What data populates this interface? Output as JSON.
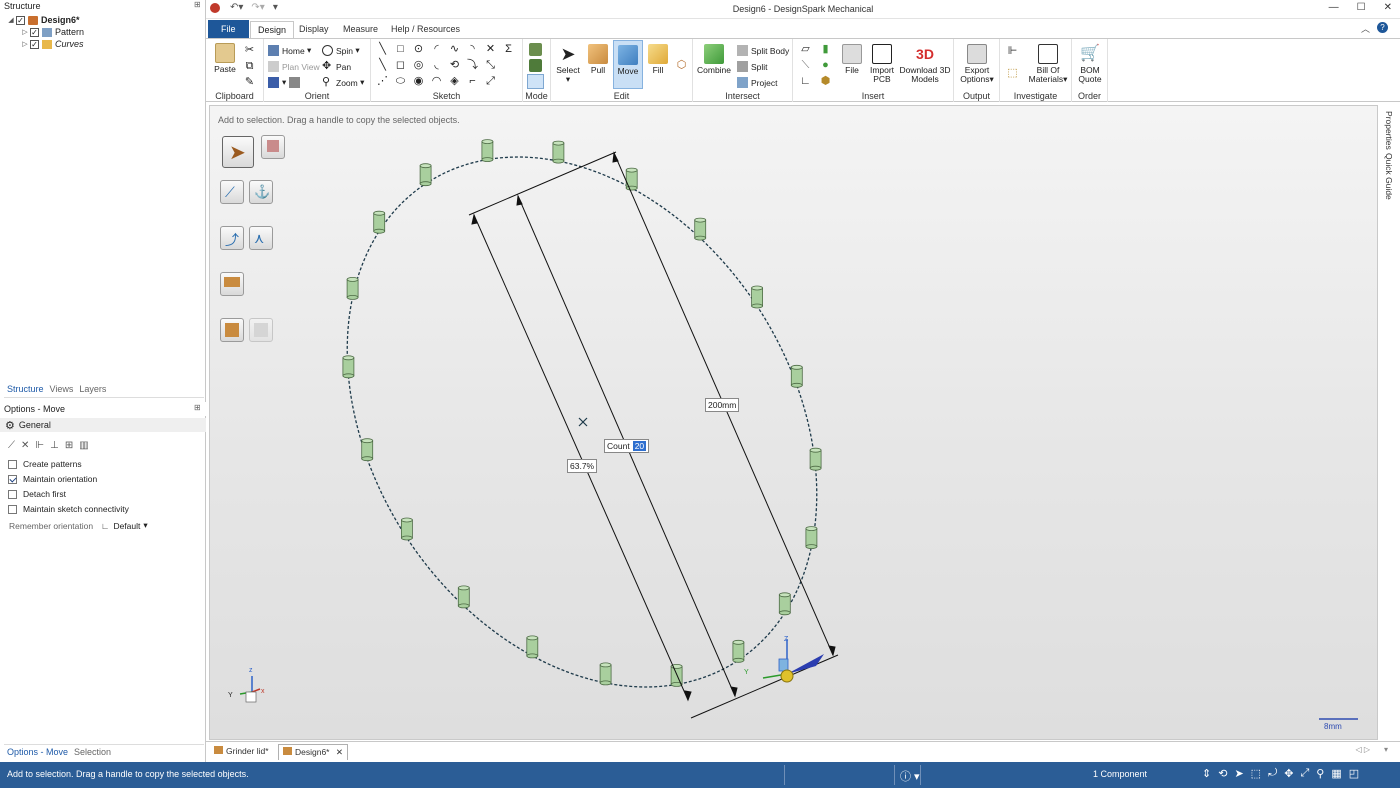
{
  "app": {
    "title": "Design6 - DesignSpark Mechanical"
  },
  "structure": {
    "header": "Structure",
    "items": [
      {
        "label": "Design6*",
        "level": 0
      },
      {
        "label": "Pattern",
        "level": 1
      },
      {
        "label": "Curves",
        "level": 1
      }
    ]
  },
  "panel_tabs": [
    "Structure",
    "Views",
    "Layers"
  ],
  "options": {
    "header": "Options - Move",
    "section": "General",
    "checkboxes": [
      {
        "label": "Create patterns",
        "checked": false
      },
      {
        "label": "Maintain orientation",
        "checked": true
      },
      {
        "label": "Detach first",
        "checked": false
      },
      {
        "label": "Maintain sketch connectivity",
        "checked": false
      }
    ],
    "remember_label": "Remember orientation",
    "remember_value": "Default"
  },
  "bottom_tabs": [
    "Options - Move",
    "Selection"
  ],
  "ribbon": {
    "tabs": [
      "File",
      "Design",
      "Display",
      "Measure",
      "Help / Resources"
    ],
    "active_tab": "Design",
    "groups": {
      "clipboard": "Clipboard",
      "orient": "Orient",
      "sketch": "Sketch",
      "mode": "Mode",
      "edit": "Edit",
      "intersect": "Intersect",
      "insert": "Insert",
      "output": "Output",
      "investigate": "Investigate",
      "order": "Order"
    },
    "buttons": {
      "paste": "Paste",
      "home": "Home",
      "spin": "Spin",
      "plan_view": "Plan View",
      "pan": "Pan",
      "zoom": "Zoom",
      "select": "Select",
      "pull": "Pull",
      "move": "Move",
      "fill": "Fill",
      "combine": "Combine",
      "split_body": "Split Body",
      "split": "Split",
      "project": "Project",
      "file": "File",
      "import_pcb_1": "Import",
      "import_pcb_2": "PCB",
      "download_1": "Download 3D",
      "download_2": "Models",
      "export_1": "Export",
      "export_2": "Options",
      "bom_1": "Bill Of",
      "bom_2": "Materials",
      "quote_1": "BOM",
      "quote_2": "Quote"
    }
  },
  "viewport": {
    "hint": "Add to selection.  Drag a handle to copy the selected objects.",
    "dim_length": "200mm",
    "percent": "63.7%",
    "count_label": "Count",
    "count_value": "20",
    "scale": "8mm"
  },
  "right_tabs": [
    "Properties",
    "Quick Guide"
  ],
  "doc_tabs": [
    "Grinder lid*",
    "Design6*"
  ],
  "status": {
    "message": "Add to selection.  Drag a handle to copy the selected objects.",
    "selection": "1 Component"
  },
  "colors": {
    "accent": "#1e5799",
    "status_bar": "#2b5d96",
    "cylinder": "#a9cf9e"
  }
}
